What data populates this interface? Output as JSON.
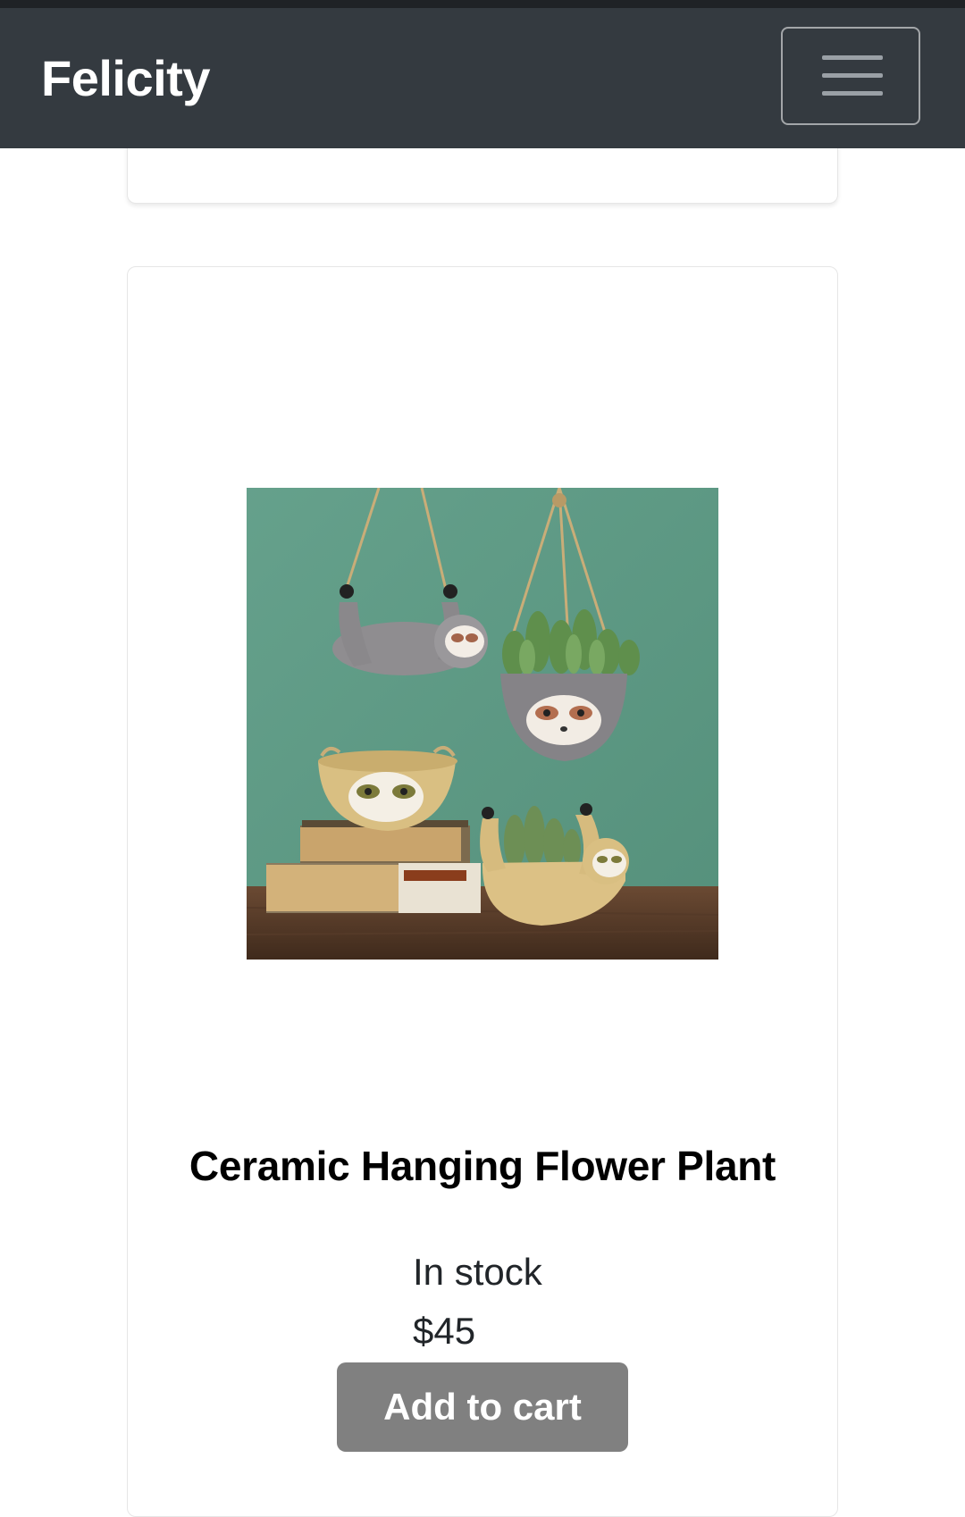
{
  "navbar": {
    "brand": "Felicity",
    "toggler_icon": "hamburger-menu-icon"
  },
  "product": {
    "image_alt": "Ceramic sloth hanging planters",
    "title": "Ceramic Hanging Flower Plant",
    "stock": "In stock",
    "price": "$45",
    "add_to_cart_label": "Add to cart"
  },
  "colors": {
    "navbar_bg": "#343a40",
    "button_bg": "#808080",
    "image_wall": "#5e9a85"
  }
}
